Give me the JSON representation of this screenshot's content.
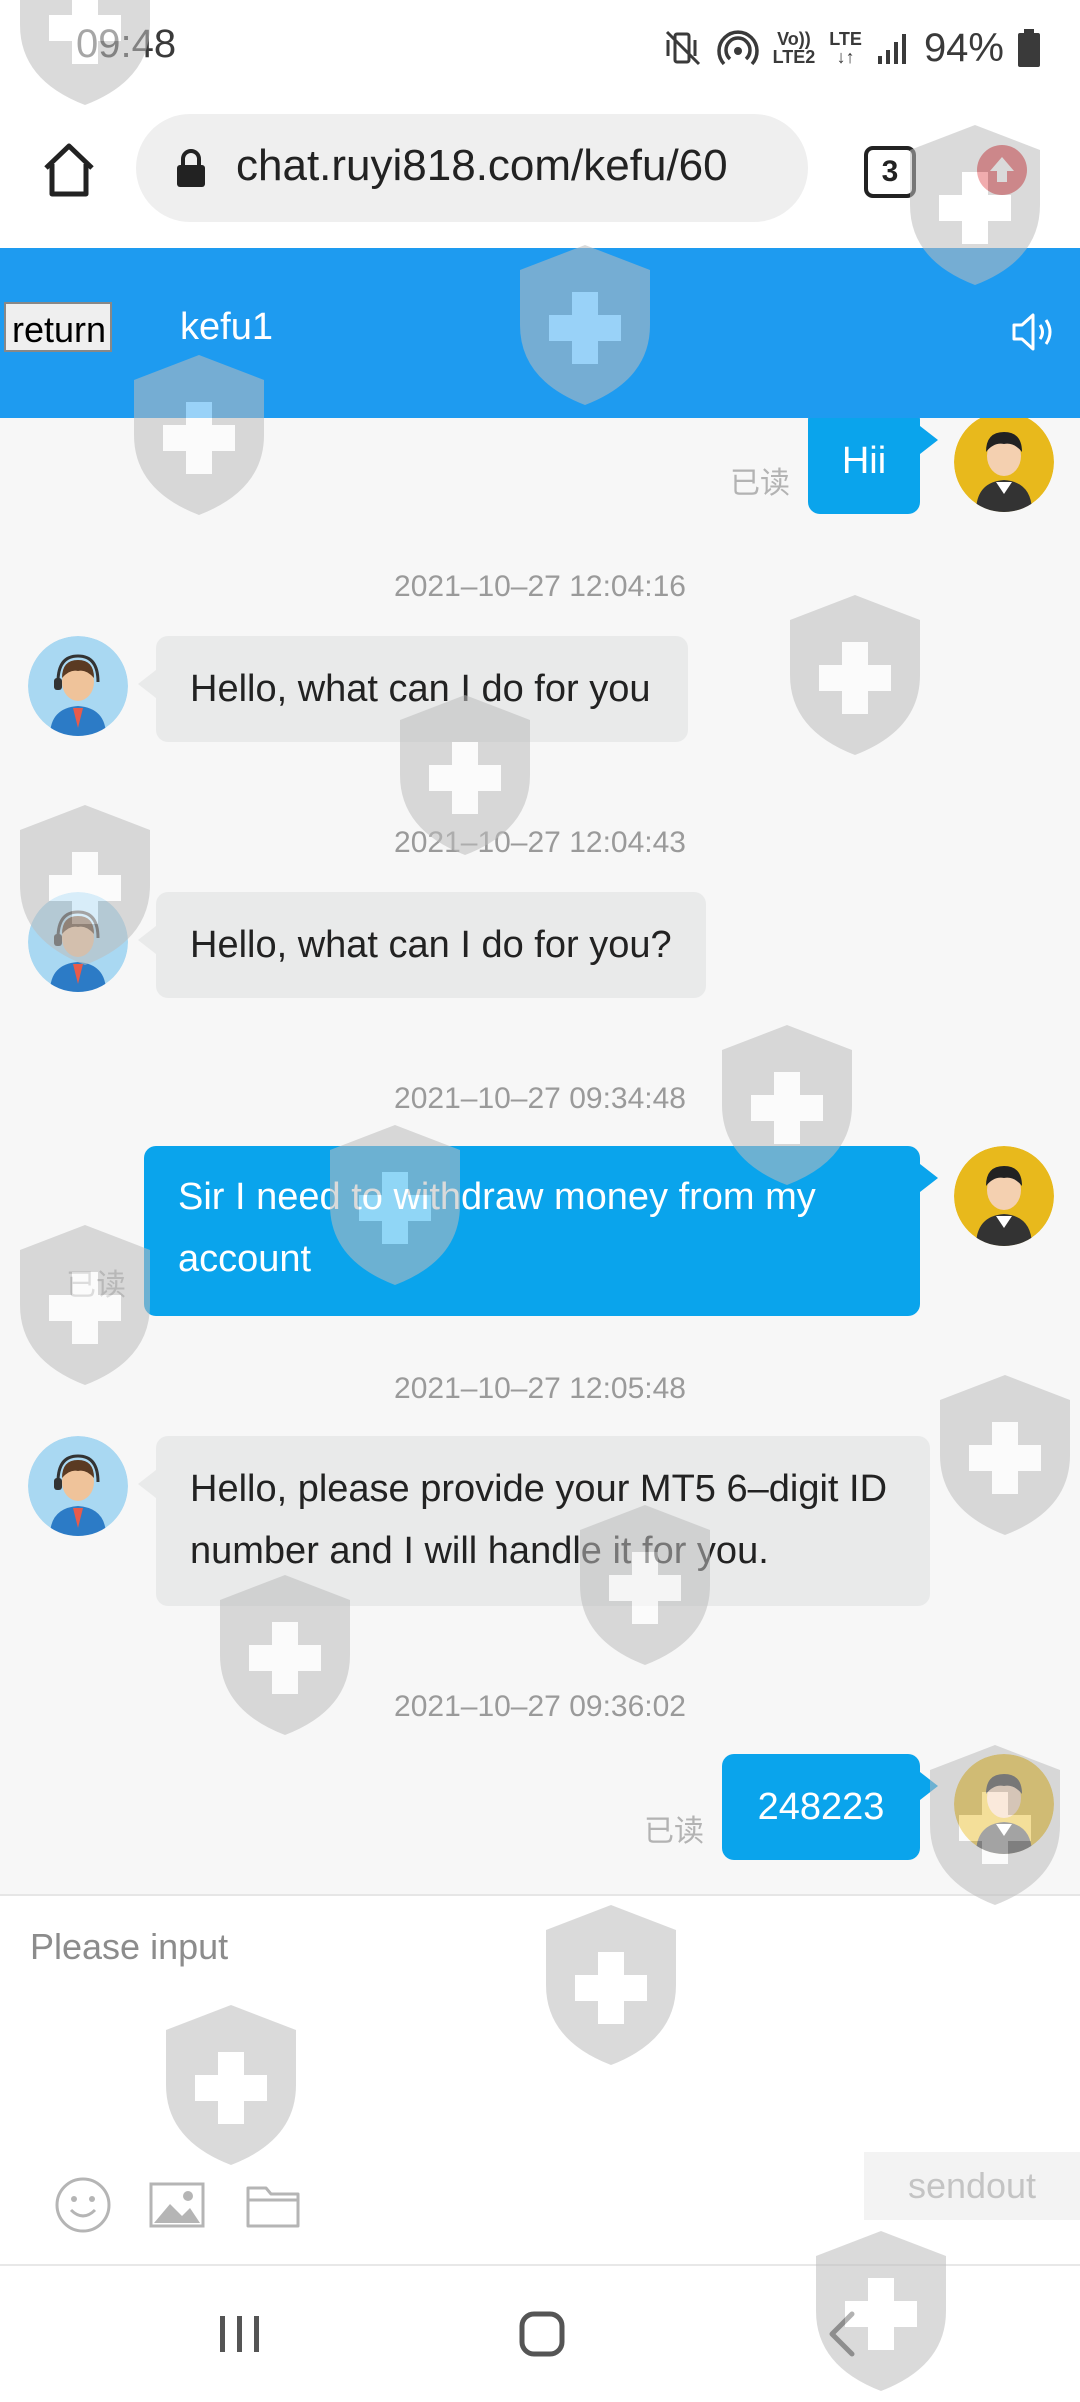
{
  "status_bar": {
    "time": "09:48",
    "volte_line1": "Vo))",
    "volte_line2": "LTE2",
    "lte_label": "LTE",
    "battery": "94%",
    "icons": [
      "mute-vibrate-icon",
      "hotspot-icon",
      "volte-icon",
      "lte-icon",
      "signal-icon",
      "battery-icon"
    ]
  },
  "browser": {
    "url": "chat.ruyi818.com/kefu/60",
    "tab_count": "3",
    "icons": [
      "home-icon",
      "lock-icon",
      "tabs-icon",
      "upload-icon"
    ]
  },
  "header": {
    "return_label": "return",
    "title": "kefu1",
    "background": "#1e9bf0"
  },
  "messages": [
    {
      "side": "out",
      "text": "Hii",
      "read": "已读"
    },
    {
      "timestamp": "2021–10–27 12:04:16",
      "side": "in",
      "text": "Hello, what can I do for you"
    },
    {
      "timestamp": "2021–10–27 12:04:43",
      "side": "in",
      "text": "Hello, what can I do for you?"
    },
    {
      "timestamp": "2021–10–27 09:34:48",
      "side": "out",
      "text_line1": "Sir I need to withdraw money from my",
      "text_line2": "account",
      "read": "已读"
    },
    {
      "timestamp": "2021–10–27 12:05:48",
      "side": "in",
      "text_line1": "Hello, please provide your MT5 6–digit ID",
      "text_line2": "number and I will handle it for you."
    },
    {
      "timestamp": "2021–10–27 09:36:02",
      "side": "out",
      "text": "248223",
      "read": "已读"
    }
  ],
  "input": {
    "placeholder": "Please input",
    "send_label": "sendout",
    "tools": [
      "emoji-icon",
      "image-icon",
      "folder-icon"
    ]
  },
  "nav": {
    "icons": [
      "recent-apps-icon",
      "home-nav-icon",
      "back-icon"
    ]
  },
  "colors": {
    "accent": "#1e9bf0",
    "outgoing_bubble": "#0aa4ec",
    "incoming_bubble": "#e9eaea"
  }
}
